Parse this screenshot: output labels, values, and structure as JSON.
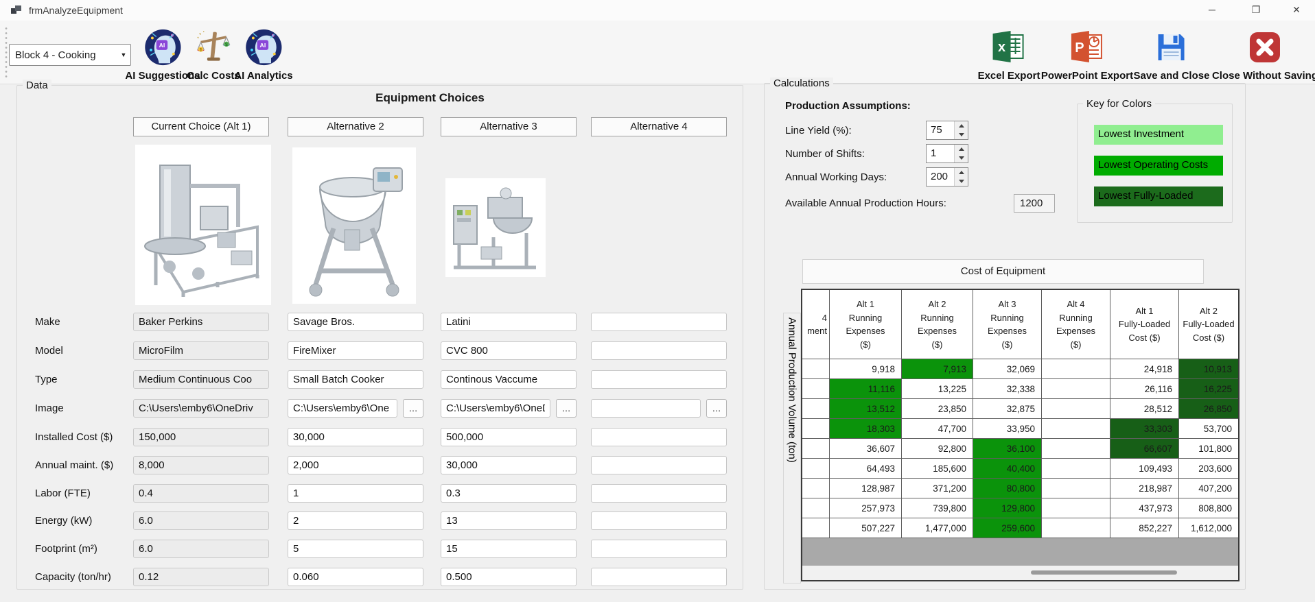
{
  "window": {
    "title": "frmAnalyzeEquipment",
    "controls": {
      "minimize": "─",
      "maximize": "❐",
      "close": "✕"
    }
  },
  "toolbar": {
    "block_selector": {
      "value": "Block 4 - Cooking"
    },
    "left_buttons": [
      {
        "label": "AI Suggestions",
        "icon": "ai-head-icon"
      },
      {
        "label": "Calc Costs",
        "icon": "scale-icon"
      },
      {
        "label": "AI Analytics",
        "icon": "ai-head-icon"
      }
    ],
    "right_buttons": [
      {
        "label": "Excel Export",
        "icon": "excel-icon"
      },
      {
        "label": "PowerPoint Export",
        "icon": "powerpoint-icon"
      },
      {
        "label": "Save and Close",
        "icon": "save-icon"
      },
      {
        "label": "Close Without Saving",
        "icon": "close-x-icon"
      }
    ]
  },
  "data_panel": {
    "group_label": "Data",
    "title": "Equipment Choices",
    "column_headers": [
      "Current Choice (Alt 1)",
      "Alternative 2",
      "Alternative 3",
      "Alternative 4"
    ],
    "row_labels": [
      "Make",
      "Model",
      "Type",
      "Image",
      "Installed Cost ($)",
      "Annual maint. ($)",
      "Labor (FTE)",
      "Energy (kW)",
      "Footprint (m²)",
      "Capacity (ton/hr)"
    ],
    "browse_label": "…",
    "columns": [
      {
        "name": "alt1",
        "readonly": true,
        "has_browse": false,
        "has_image": true,
        "values": [
          "Baker Perkins",
          "MicroFilm",
          "Medium Continuous Coo",
          "C:\\Users\\emby6\\OneDriv",
          "150,000",
          "8,000",
          "0.4",
          "6.0",
          "6.0",
          "0.12"
        ]
      },
      {
        "name": "alt2",
        "readonly": false,
        "has_browse": true,
        "has_image": true,
        "values": [
          "Savage Bros.",
          "FireMixer",
          "Small Batch Cooker",
          "C:\\Users\\emby6\\One",
          "30,000",
          "2,000",
          "1",
          "2",
          "5",
          "0.060"
        ]
      },
      {
        "name": "alt3",
        "readonly": false,
        "has_browse": true,
        "has_image": true,
        "values": [
          "Latini",
          "CVC 800",
          "Continous Vaccume",
          "C:\\Users\\emby6\\OneD",
          "500,000",
          "30,000",
          "0.3",
          "13",
          "15",
          "0.500"
        ]
      },
      {
        "name": "alt4",
        "readonly": false,
        "has_browse": true,
        "has_image": false,
        "values": [
          "",
          "",
          "",
          "",
          "",
          "",
          "",
          "",
          "",
          ""
        ]
      }
    ]
  },
  "calculations": {
    "group_label": "Calculations",
    "assumptions_title": "Production Assumptions:",
    "fields": [
      {
        "label": "Line Yield (%):",
        "value": "75"
      },
      {
        "label": "Number of Shifts:",
        "value": "1"
      },
      {
        "label": "Annual Working Days:",
        "value": "200"
      }
    ],
    "hours_label": "Available Annual Production Hours:",
    "hours_value": "1200",
    "color_key": {
      "label": "Key for Colors",
      "items": [
        {
          "label": "Lowest Investment",
          "color": "#90ee90"
        },
        {
          "label": "Lowest Operating Costs",
          "color": "#00ac00"
        },
        {
          "label": "Lowest Fully-Loaded",
          "color": "#1c6b1c"
        }
      ]
    },
    "cost_table": {
      "title": "Cost of Equipment",
      "y_axis_label": "Annual Production Volume (ton)",
      "cell_colors": {
        "op": "#0b930b",
        "fl": "#175f17"
      },
      "clipped_header_lines": [
        "4",
        "ment"
      ],
      "headers": [
        [
          "Alt 1",
          "Running",
          "Expenses",
          "($)"
        ],
        [
          "Alt 2",
          "Running",
          "Expenses",
          "($)"
        ],
        [
          "Alt 3",
          "Running",
          "Expenses",
          "($)"
        ],
        [
          "Alt 4",
          "Running",
          "Expenses",
          "($)"
        ],
        [
          "Alt 1",
          "Fully-Loaded",
          "Cost ($)"
        ],
        [
          "Alt 2",
          "Fully-Loaded",
          "Cost ($)"
        ]
      ],
      "rows": [
        [
          {
            "v": "9,918"
          },
          {
            "v": "7,913",
            "hl": "op"
          },
          {
            "v": "32,069"
          },
          {
            "v": ""
          },
          {
            "v": "24,918"
          },
          {
            "v": "10,913",
            "hl": "fl"
          }
        ],
        [
          {
            "v": "11,116",
            "hl": "op"
          },
          {
            "v": "13,225"
          },
          {
            "v": "32,338"
          },
          {
            "v": ""
          },
          {
            "v": "26,116"
          },
          {
            "v": "16,225",
            "hl": "fl"
          }
        ],
        [
          {
            "v": "13,512",
            "hl": "op"
          },
          {
            "v": "23,850"
          },
          {
            "v": "32,875"
          },
          {
            "v": ""
          },
          {
            "v": "28,512"
          },
          {
            "v": "26,850",
            "hl": "fl"
          }
        ],
        [
          {
            "v": "18,303",
            "hl": "op"
          },
          {
            "v": "47,700"
          },
          {
            "v": "33,950"
          },
          {
            "v": ""
          },
          {
            "v": "33,303",
            "hl": "fl"
          },
          {
            "v": "53,700"
          }
        ],
        [
          {
            "v": "36,607"
          },
          {
            "v": "92,800"
          },
          {
            "v": "36,100",
            "hl": "op"
          },
          {
            "v": ""
          },
          {
            "v": "66,607",
            "hl": "fl"
          },
          {
            "v": "101,800"
          }
        ],
        [
          {
            "v": "64,493"
          },
          {
            "v": "185,600"
          },
          {
            "v": "40,400",
            "hl": "op"
          },
          {
            "v": ""
          },
          {
            "v": "109,493"
          },
          {
            "v": "203,600"
          }
        ],
        [
          {
            "v": "128,987"
          },
          {
            "v": "371,200"
          },
          {
            "v": "80,800",
            "hl": "op"
          },
          {
            "v": ""
          },
          {
            "v": "218,987"
          },
          {
            "v": "407,200"
          }
        ],
        [
          {
            "v": "257,973"
          },
          {
            "v": "739,800"
          },
          {
            "v": "129,800",
            "hl": "op"
          },
          {
            "v": ""
          },
          {
            "v": "437,973"
          },
          {
            "v": "808,800"
          }
        ],
        [
          {
            "v": "507,227"
          },
          {
            "v": "1,477,000"
          },
          {
            "v": "259,600",
            "hl": "op"
          },
          {
            "v": ""
          },
          {
            "v": "852,227"
          },
          {
            "v": "1,612,000"
          }
        ]
      ]
    }
  }
}
